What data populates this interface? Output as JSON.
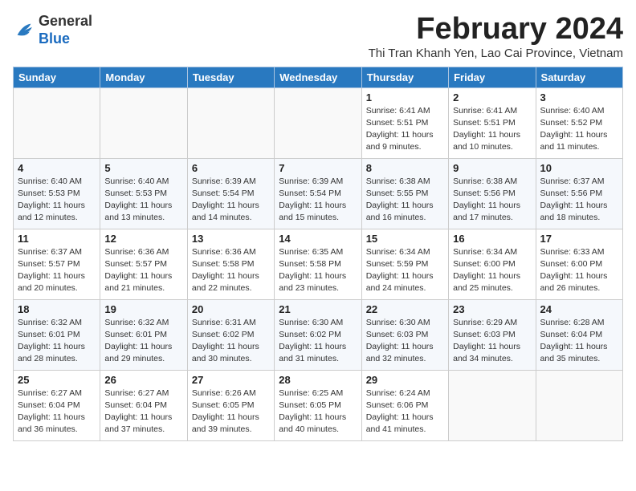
{
  "header": {
    "logo_line1": "General",
    "logo_line2": "Blue",
    "month_title": "February 2024",
    "subtitle": "Thi Tran Khanh Yen, Lao Cai Province, Vietnam"
  },
  "days_of_week": [
    "Sunday",
    "Monday",
    "Tuesday",
    "Wednesday",
    "Thursday",
    "Friday",
    "Saturday"
  ],
  "weeks": [
    [
      {
        "day": "",
        "info": ""
      },
      {
        "day": "",
        "info": ""
      },
      {
        "day": "",
        "info": ""
      },
      {
        "day": "",
        "info": ""
      },
      {
        "day": "1",
        "info": "Sunrise: 6:41 AM\nSunset: 5:51 PM\nDaylight: 11 hours\nand 9 minutes."
      },
      {
        "day": "2",
        "info": "Sunrise: 6:41 AM\nSunset: 5:51 PM\nDaylight: 11 hours\nand 10 minutes."
      },
      {
        "day": "3",
        "info": "Sunrise: 6:40 AM\nSunset: 5:52 PM\nDaylight: 11 hours\nand 11 minutes."
      }
    ],
    [
      {
        "day": "4",
        "info": "Sunrise: 6:40 AM\nSunset: 5:53 PM\nDaylight: 11 hours\nand 12 minutes."
      },
      {
        "day": "5",
        "info": "Sunrise: 6:40 AM\nSunset: 5:53 PM\nDaylight: 11 hours\nand 13 minutes."
      },
      {
        "day": "6",
        "info": "Sunrise: 6:39 AM\nSunset: 5:54 PM\nDaylight: 11 hours\nand 14 minutes."
      },
      {
        "day": "7",
        "info": "Sunrise: 6:39 AM\nSunset: 5:54 PM\nDaylight: 11 hours\nand 15 minutes."
      },
      {
        "day": "8",
        "info": "Sunrise: 6:38 AM\nSunset: 5:55 PM\nDaylight: 11 hours\nand 16 minutes."
      },
      {
        "day": "9",
        "info": "Sunrise: 6:38 AM\nSunset: 5:56 PM\nDaylight: 11 hours\nand 17 minutes."
      },
      {
        "day": "10",
        "info": "Sunrise: 6:37 AM\nSunset: 5:56 PM\nDaylight: 11 hours\nand 18 minutes."
      }
    ],
    [
      {
        "day": "11",
        "info": "Sunrise: 6:37 AM\nSunset: 5:57 PM\nDaylight: 11 hours\nand 20 minutes."
      },
      {
        "day": "12",
        "info": "Sunrise: 6:36 AM\nSunset: 5:57 PM\nDaylight: 11 hours\nand 21 minutes."
      },
      {
        "day": "13",
        "info": "Sunrise: 6:36 AM\nSunset: 5:58 PM\nDaylight: 11 hours\nand 22 minutes."
      },
      {
        "day": "14",
        "info": "Sunrise: 6:35 AM\nSunset: 5:58 PM\nDaylight: 11 hours\nand 23 minutes."
      },
      {
        "day": "15",
        "info": "Sunrise: 6:34 AM\nSunset: 5:59 PM\nDaylight: 11 hours\nand 24 minutes."
      },
      {
        "day": "16",
        "info": "Sunrise: 6:34 AM\nSunset: 6:00 PM\nDaylight: 11 hours\nand 25 minutes."
      },
      {
        "day": "17",
        "info": "Sunrise: 6:33 AM\nSunset: 6:00 PM\nDaylight: 11 hours\nand 26 minutes."
      }
    ],
    [
      {
        "day": "18",
        "info": "Sunrise: 6:32 AM\nSunset: 6:01 PM\nDaylight: 11 hours\nand 28 minutes."
      },
      {
        "day": "19",
        "info": "Sunrise: 6:32 AM\nSunset: 6:01 PM\nDaylight: 11 hours\nand 29 minutes."
      },
      {
        "day": "20",
        "info": "Sunrise: 6:31 AM\nSunset: 6:02 PM\nDaylight: 11 hours\nand 30 minutes."
      },
      {
        "day": "21",
        "info": "Sunrise: 6:30 AM\nSunset: 6:02 PM\nDaylight: 11 hours\nand 31 minutes."
      },
      {
        "day": "22",
        "info": "Sunrise: 6:30 AM\nSunset: 6:03 PM\nDaylight: 11 hours\nand 32 minutes."
      },
      {
        "day": "23",
        "info": "Sunrise: 6:29 AM\nSunset: 6:03 PM\nDaylight: 11 hours\nand 34 minutes."
      },
      {
        "day": "24",
        "info": "Sunrise: 6:28 AM\nSunset: 6:04 PM\nDaylight: 11 hours\nand 35 minutes."
      }
    ],
    [
      {
        "day": "25",
        "info": "Sunrise: 6:27 AM\nSunset: 6:04 PM\nDaylight: 11 hours\nand 36 minutes."
      },
      {
        "day": "26",
        "info": "Sunrise: 6:27 AM\nSunset: 6:04 PM\nDaylight: 11 hours\nand 37 minutes."
      },
      {
        "day": "27",
        "info": "Sunrise: 6:26 AM\nSunset: 6:05 PM\nDaylight: 11 hours\nand 39 minutes."
      },
      {
        "day": "28",
        "info": "Sunrise: 6:25 AM\nSunset: 6:05 PM\nDaylight: 11 hours\nand 40 minutes."
      },
      {
        "day": "29",
        "info": "Sunrise: 6:24 AM\nSunset: 6:06 PM\nDaylight: 11 hours\nand 41 minutes."
      },
      {
        "day": "",
        "info": ""
      },
      {
        "day": "",
        "info": ""
      }
    ]
  ]
}
